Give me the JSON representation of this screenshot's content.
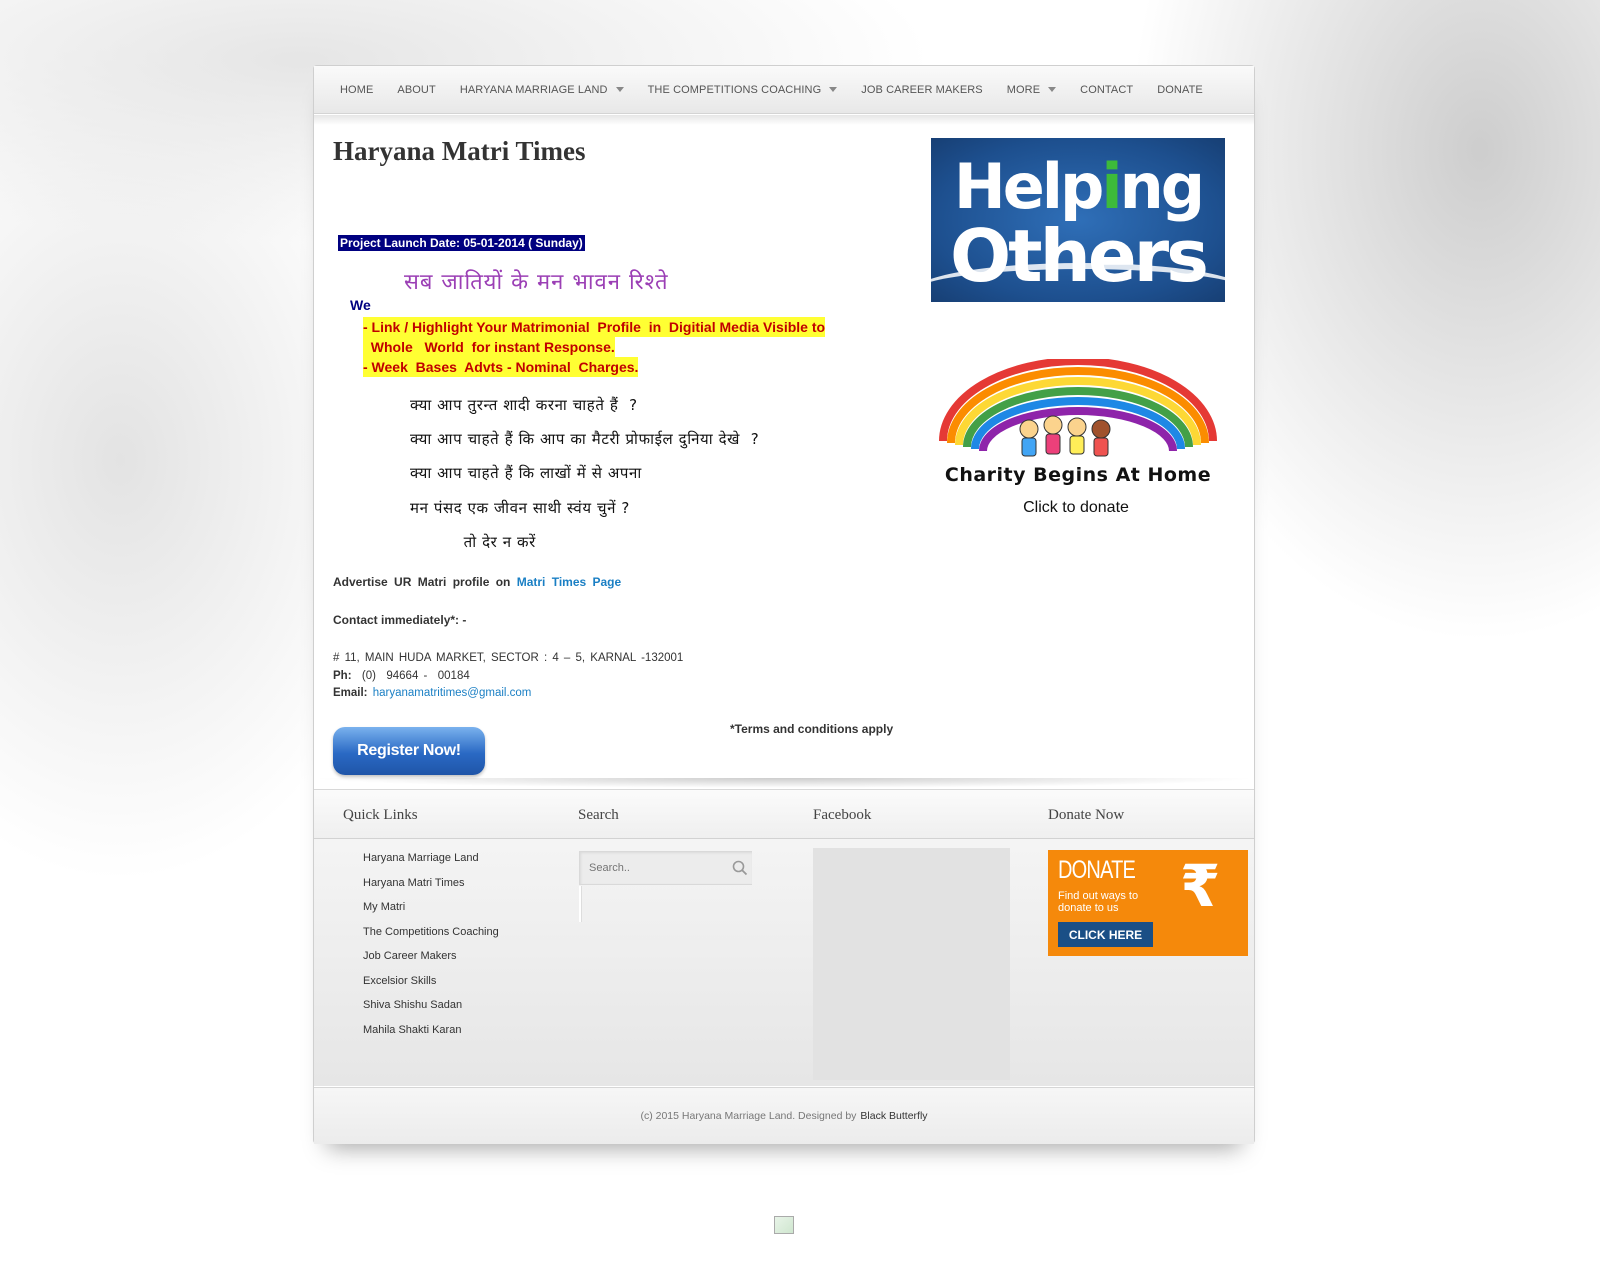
{
  "nav": {
    "items": [
      {
        "label": "HOME",
        "has_dropdown": false
      },
      {
        "label": "ABOUT",
        "has_dropdown": false
      },
      {
        "label": "HARYANA MARRIAGE LAND",
        "has_dropdown": true
      },
      {
        "label": "THE COMPETITIONS COACHING",
        "has_dropdown": true
      },
      {
        "label": "JOB CAREER MAKERS",
        "has_dropdown": false
      },
      {
        "label": "MORE",
        "has_dropdown": true
      },
      {
        "label": "CONTACT",
        "has_dropdown": false
      },
      {
        "label": "DONATE",
        "has_dropdown": false
      }
    ]
  },
  "main": {
    "title": "Haryana Matri Times",
    "launch_date": "Project Launch Date:  05-01-2014   ( Sunday)",
    "hindi_heading": "सब जातियों के मन भावन रिश्ते",
    "we": "We",
    "highlights": [
      "- Link / Highlight Your Matrimonial  Profile  in  Digitial Media Visible to",
      "  Whole   World  for instant Response.",
      "- Week  Bases  Advts - Nominal  Charges."
    ],
    "hindi_questions": [
      "क्या आप तुरन्त शादी करना चाहते हैं  ?",
      "क्या आप चाहते हैं कि आप का मैटरी प्रोफाईल दुनिया देखे  ?",
      "क्या आप चाहते हैं कि लाखों में से अपना",
      "मन पंसद एक जीवन साथी स्वंय चुनें ?",
      "          तो देर न करें"
    ],
    "advertise_prefix": "Advertise  UR  Matri  profile  on",
    "advertise_link": "Matri Times Page",
    "contact_immediately": "Contact  immediately*: -",
    "address": "#  11,  MAIN  HUDA  MARKET, SECTOR :  4 – 5,  KARNAL -132001",
    "phone_label": "Ph:",
    "phone": "  (0)  94664 -  00184",
    "email_label": "Email:",
    "email": "haryanamatritimes@gmail.com",
    "terms": "*Terms and conditions apply",
    "register_button": "Register Now!"
  },
  "sidebar": {
    "helping_line1_a": "Help",
    "helping_line1_b": "i",
    "helping_line1_c": "ng",
    "helping_line2": "Others",
    "charity_text": "Charity Begins At Home",
    "click_to_donate": "Click to donate"
  },
  "footer": {
    "quick_links_title": "Quick Links",
    "search_title": "Search",
    "facebook_title": "Facebook",
    "donate_title": "Donate Now",
    "quick_links": [
      "Haryana Marriage Land",
      "Haryana Matri Times",
      "My Matri",
      "The Competitions Coaching",
      "Job Career Makers",
      "Excelsior Skills",
      "Shiva Shishu Sadan",
      "Mahila Shakti Karan"
    ],
    "search_placeholder": "Search..",
    "donate_banner": {
      "title": "DONATE",
      "subtitle": "Find out ways to donate to us",
      "symbol": "₹",
      "button": "CLICK HERE"
    },
    "copyright": "(c) 2015 Haryana Marriage Land. Designed by",
    "designer": "Black Butterfly"
  },
  "colors": {
    "launch_bg": "#000080",
    "highlight_bg": "#ffff33",
    "highlight_text": "#c00000",
    "hindi_heading": "#9b3fb5",
    "link": "#1a7fc4",
    "donate_orange": "#f5890b"
  }
}
